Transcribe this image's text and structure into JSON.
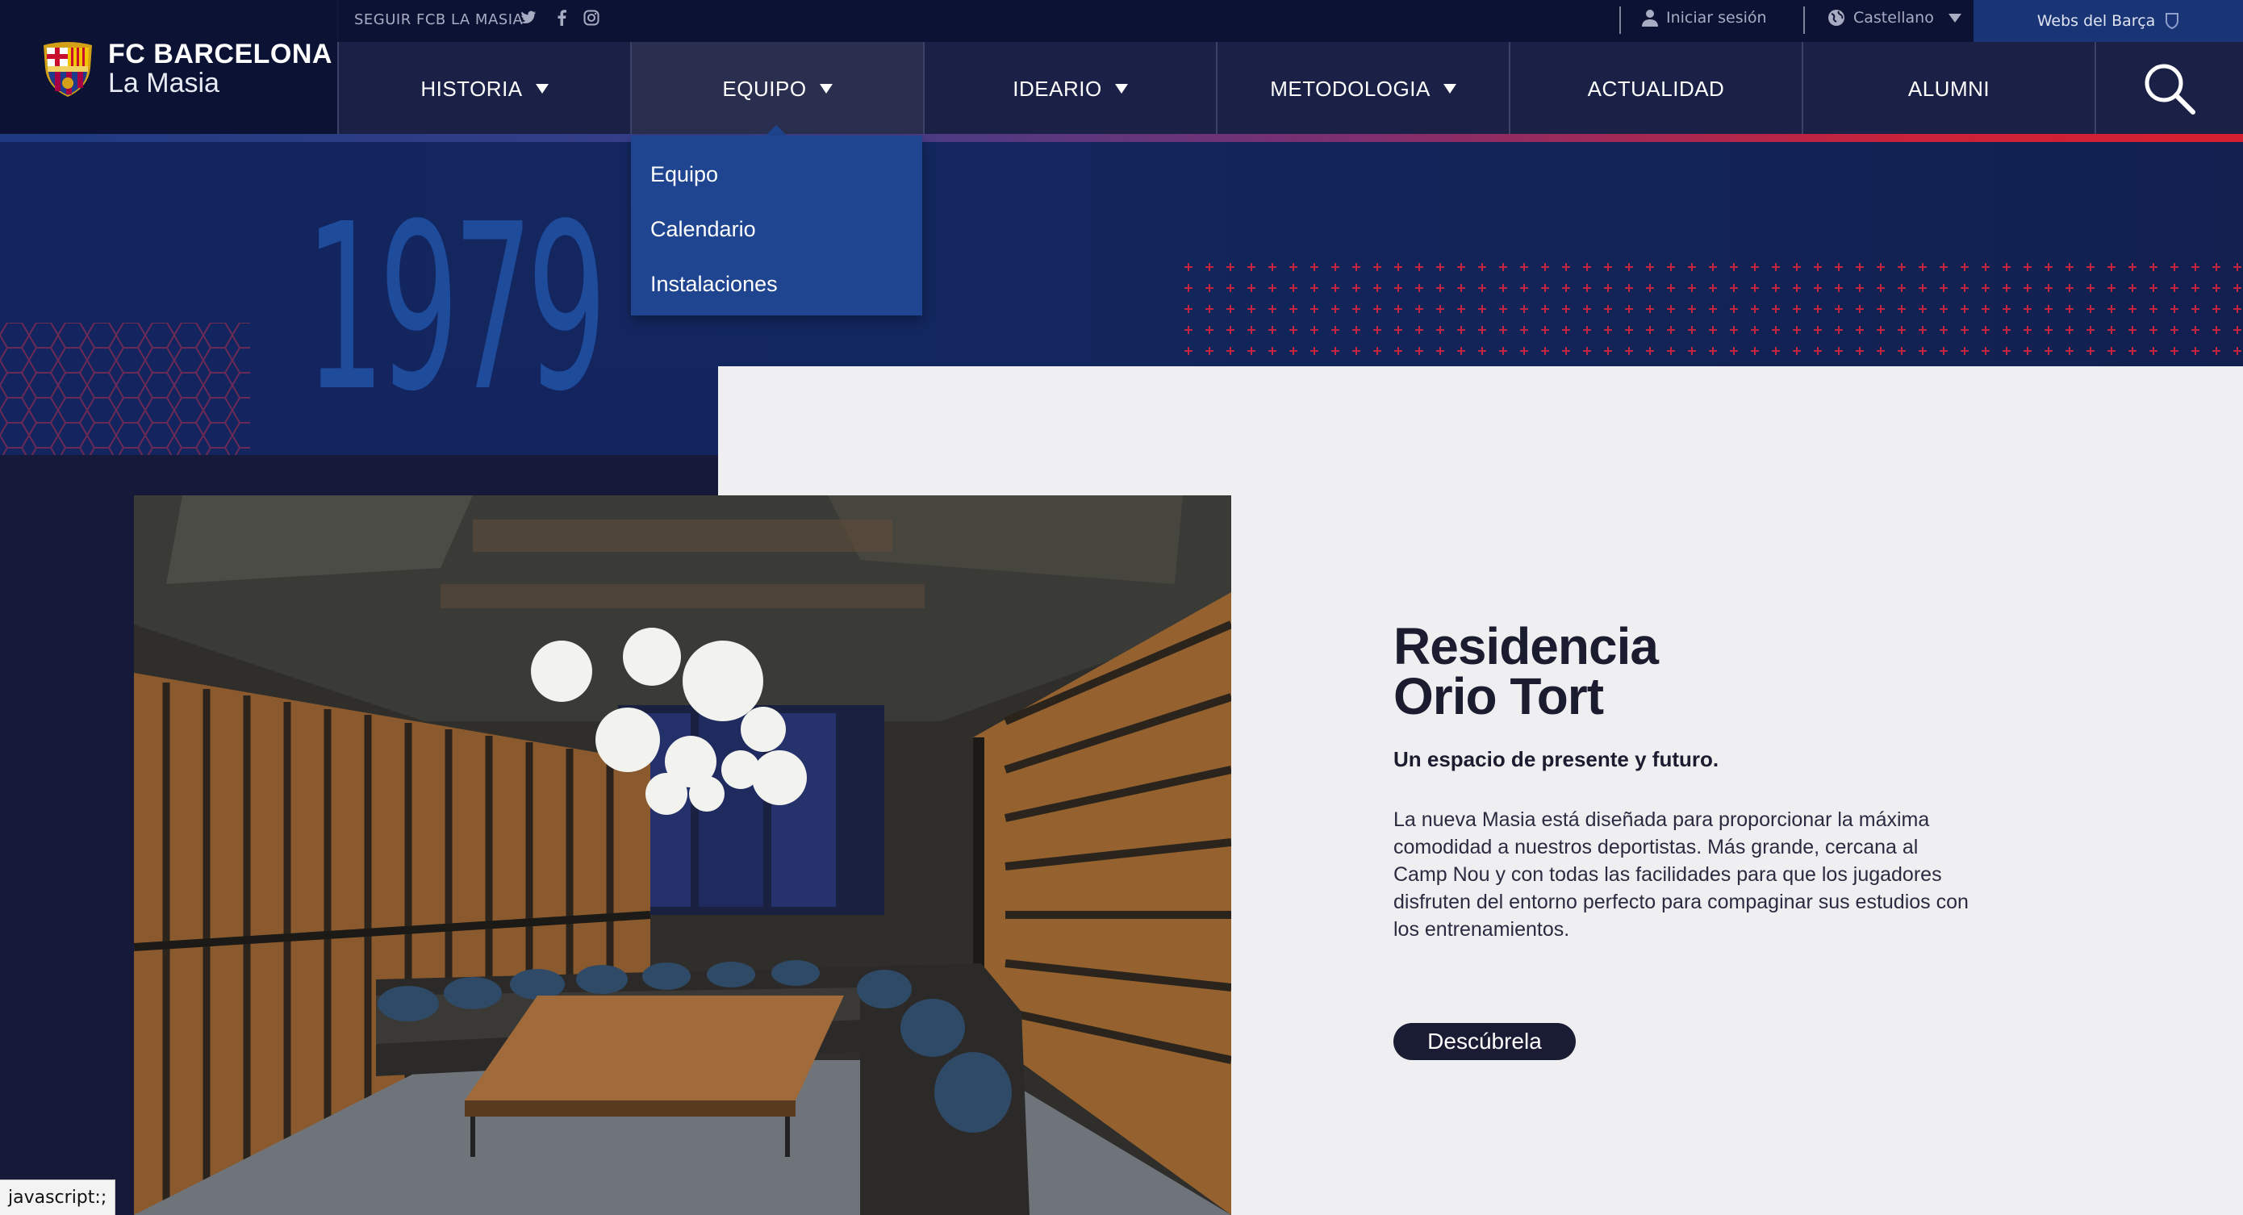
{
  "topbar": {
    "follow_label": "SEGUIR FCB LA MASIA",
    "social": [
      "twitter-icon",
      "facebook-icon",
      "instagram-icon"
    ],
    "login_label": "Iniciar sesión",
    "language_label": "Castellano",
    "webs_label": "Webs del Barça"
  },
  "brand": {
    "name": "FC BARCELONA",
    "sub": "La Masia"
  },
  "nav": {
    "items": [
      {
        "label": "HISTORIA",
        "has_menu": true
      },
      {
        "label": "EQUIPO",
        "has_menu": true
      },
      {
        "label": "IDEARIO",
        "has_menu": true
      },
      {
        "label": "METODOLOGIA",
        "has_menu": true
      },
      {
        "label": "ACTUALIDAD",
        "has_menu": false
      },
      {
        "label": "ALUMNI",
        "has_menu": false
      }
    ],
    "dropdown": [
      "Equipo",
      "Calendario",
      "Instalaciones"
    ]
  },
  "hero": {
    "year": "1979"
  },
  "feature": {
    "title_line1": "Residencia",
    "title_line2": "Orio Tort",
    "subtitle": "Un espacio de presente y futuro.",
    "body": "La nueva Masia está diseñada para proporcionar la máxima comodidad a nuestros deportistas. Más grande, cercana al Camp Nou y con todas las facilidades para que los jugadores disfruten del entorno perfecto para compaginar sus estudios con los entrenamientos.",
    "cta_label": "Descúbrela"
  },
  "status_bar": "javascript:;",
  "colors": {
    "navy": "#0b1233",
    "blaugrana_blue": "#1f4590",
    "accent_red": "#d51f2f",
    "panel": "#efeff1"
  }
}
